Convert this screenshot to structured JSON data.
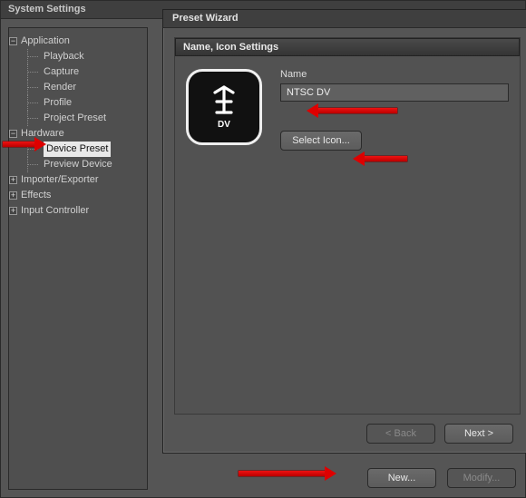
{
  "window": {
    "title": "System Settings"
  },
  "tree": {
    "application": {
      "label": "Application",
      "items": [
        "Playback",
        "Capture",
        "Render",
        "Profile",
        "Project Preset"
      ]
    },
    "hardware": {
      "label": "Hardware",
      "items": [
        "Device Preset",
        "Preview Device"
      ],
      "selected": "Device Preset"
    },
    "importer": {
      "label": "Importer/Exporter"
    },
    "effects": {
      "label": "Effects"
    },
    "input_controller": {
      "label": "Input Controller"
    }
  },
  "underlying_buttons": {
    "new": "New...",
    "modify": "Modify..."
  },
  "wizard": {
    "title": "Preset Wizard",
    "section": "Name, Icon Settings",
    "name_label": "Name",
    "name_value": "NTSC DV",
    "icon_caption": "DV",
    "select_icon": "Select Icon...",
    "back": "< Back",
    "next": "Next >"
  }
}
